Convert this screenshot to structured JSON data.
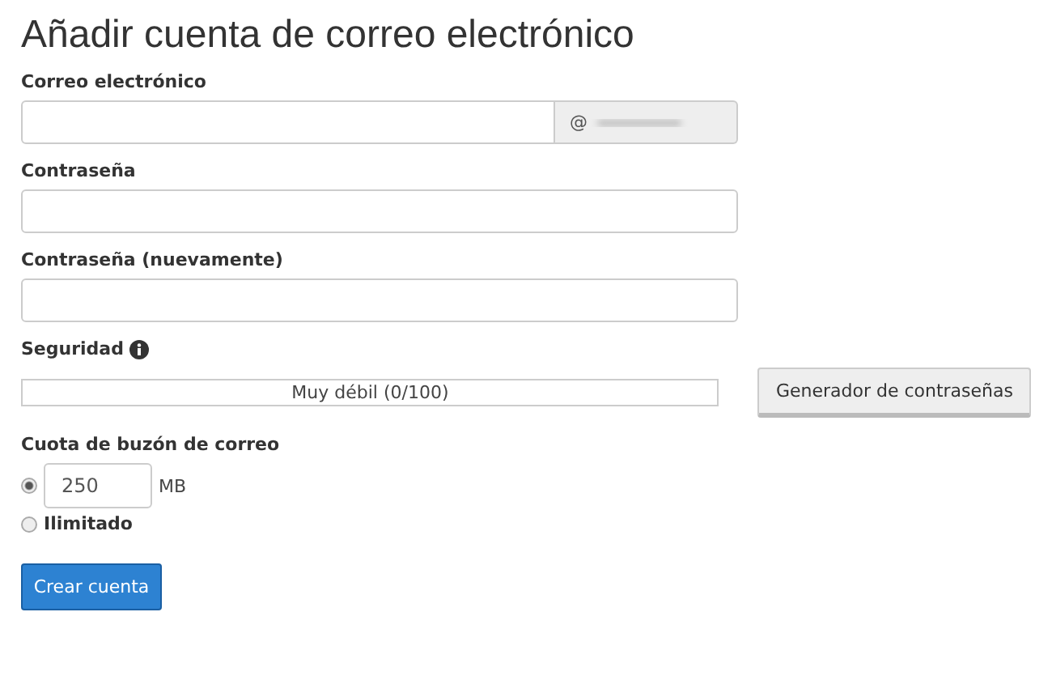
{
  "title": "Añadir cuenta de correo electrónico",
  "fields": [
    {
      "kind": "email",
      "label": "Correo electrónico",
      "addon": "@"
    },
    {
      "kind": "password",
      "label": "Contraseña"
    },
    {
      "kind": "password",
      "label": "Contraseña (nuevamente)"
    }
  ],
  "security": {
    "label": "Seguridad",
    "level": 0,
    "reading": "Muy débil (0/100)",
    "button": "Generador de contraseñas"
  },
  "quota": {
    "label": "Cuota de buzón de correo",
    "options": [
      {
        "kind": "amount",
        "selected": true,
        "value": "250",
        "unit": "MB"
      },
      {
        "kind": "unlimited",
        "selected": false,
        "label": "Ilimitado"
      }
    ]
  },
  "submit": "Crear cuenta"
}
